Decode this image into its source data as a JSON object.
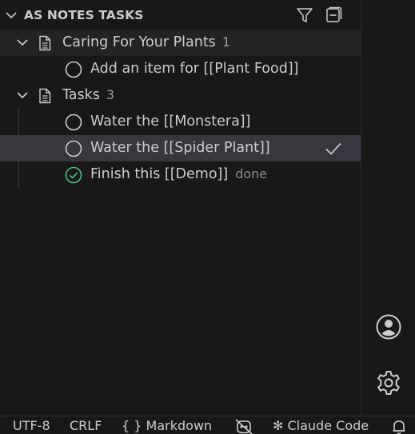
{
  "panel": {
    "title": "AS NOTES TASKS",
    "actions": [
      {
        "name": "filter",
        "icon": "filter-icon"
      },
      {
        "name": "collapse-all",
        "icon": "collapse-all-icon"
      }
    ]
  },
  "groups": [
    {
      "file_name": "Caring For Your Plants",
      "count": "1",
      "expanded": true,
      "tasks": [
        {
          "text": "Add an item for [[Plant Food]]",
          "done": false,
          "status": ""
        }
      ]
    },
    {
      "file_name": "Tasks",
      "count": "3",
      "expanded": true,
      "tasks": [
        {
          "text": "Water the [[Monstera]]",
          "done": false,
          "status": ""
        },
        {
          "text": "Water the [[Spider Plant]]",
          "done": false,
          "status": "",
          "selected": true,
          "hover_action": "check-icon"
        },
        {
          "text": "Finish this [[Demo]]",
          "done": true,
          "status": "done"
        }
      ]
    }
  ],
  "activity": [
    {
      "name": "accounts",
      "icon": "account-icon"
    },
    {
      "name": "manage",
      "icon": "gear-icon"
    }
  ],
  "statusbar": {
    "encoding": "UTF-8",
    "line_ending": "CRLF",
    "language_braces": "{ }",
    "language": "Markdown",
    "copilot_icon": "copilot-disabled-icon",
    "claude": "✻ Claude Code",
    "notifications_icon": "bell-icon"
  },
  "colors": {
    "background": "#181818",
    "selected_row": "#37373d",
    "sticky_row": "#222325",
    "done_green": "#4ec27f",
    "text": "#cccccc",
    "muted": "#9d9d9d"
  }
}
